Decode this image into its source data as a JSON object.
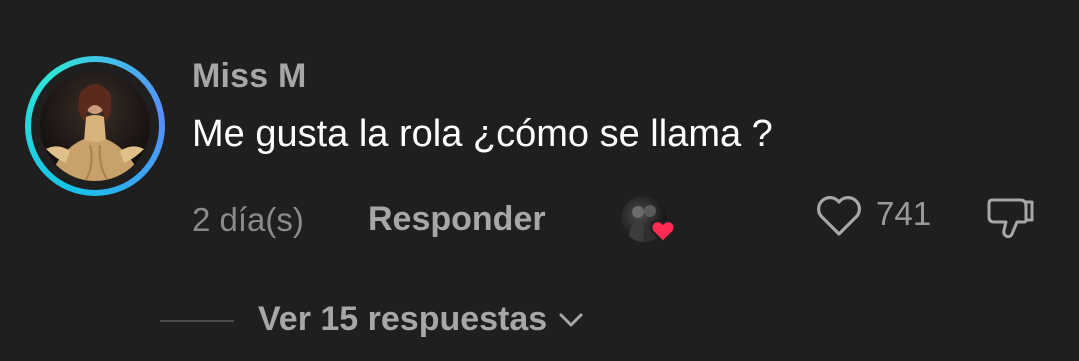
{
  "comment": {
    "username": "Miss M",
    "text": "Me gusta la rola ¿cómo se llama ?",
    "timestamp": "2 día(s)",
    "reply_label": "Responder",
    "like_count": "741",
    "view_replies_label": "Ver 15 respuestas",
    "liked_by_creator": true
  },
  "colors": {
    "background": "#1f1f1f",
    "ring_accent": "#16c2e8",
    "heart_badge": "#fe2c55",
    "primary_text": "#ffffff",
    "secondary_text": "#a7a7a7"
  },
  "icons": {
    "like": "heart-outline-icon",
    "dislike": "thumbs-down-icon",
    "expand": "chevron-down-icon",
    "creator_like_badge": "heart-icon"
  }
}
